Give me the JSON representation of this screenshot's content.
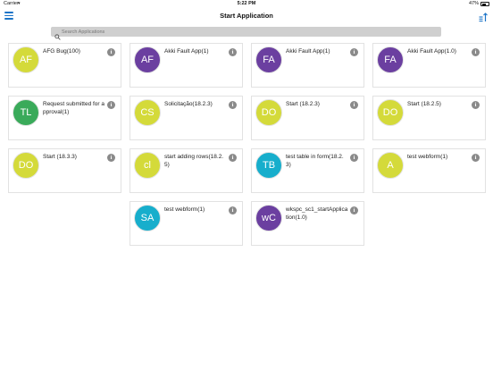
{
  "status_bar": {
    "carrier": "Carrier",
    "time": "5:22 PM",
    "battery": "47%"
  },
  "nav": {
    "title": "Start Application"
  },
  "search": {
    "placeholder": "Search Applications"
  },
  "colors": {
    "purple": "#6b3fa0",
    "lime": "#d4da3a",
    "green": "#3aaa5a",
    "teal": "#17aecc"
  },
  "apps": [
    {
      "initials": "AF",
      "label": "AFG Bug(100)",
      "color": "#d4da3a"
    },
    {
      "initials": "AF",
      "label": "Akki Fault App(1)",
      "color": "#6b3fa0"
    },
    {
      "initials": "FA",
      "label": "Akki Fault App(1)",
      "color": "#6b3fa0"
    },
    {
      "initials": "FA",
      "label": "Akki Fault App(1.0)",
      "color": "#6b3fa0"
    },
    {
      "initials": "TL",
      "label": "Request submitted for approval(1)",
      "color": "#3aaa5a"
    },
    {
      "initials": "CS",
      "label": "Solicitação(18.2.3)",
      "color": "#d4da3a"
    },
    {
      "initials": "DO",
      "label": "Start (18.2.3)",
      "color": "#d4da3a"
    },
    {
      "initials": "DO",
      "label": "Start (18.2.5)",
      "color": "#d4da3a"
    },
    {
      "initials": "DO",
      "label": "Start (18.3.3)",
      "color": "#d4da3a"
    },
    {
      "initials": "cl",
      "label": "start adding rows(18.2.5)",
      "color": "#d4da3a"
    },
    {
      "initials": "TB",
      "label": "test table in form(18.2.3)",
      "color": "#17aecc"
    },
    {
      "initials": "A",
      "label": "test webform(1)",
      "color": "#d4da3a"
    },
    {
      "initials": "SA",
      "label": "test webform(1)",
      "color": "#17aecc"
    },
    {
      "initials": "wC",
      "label": "wkspc_sc1_startApplication(1.0)",
      "color": "#6b3fa0"
    }
  ]
}
